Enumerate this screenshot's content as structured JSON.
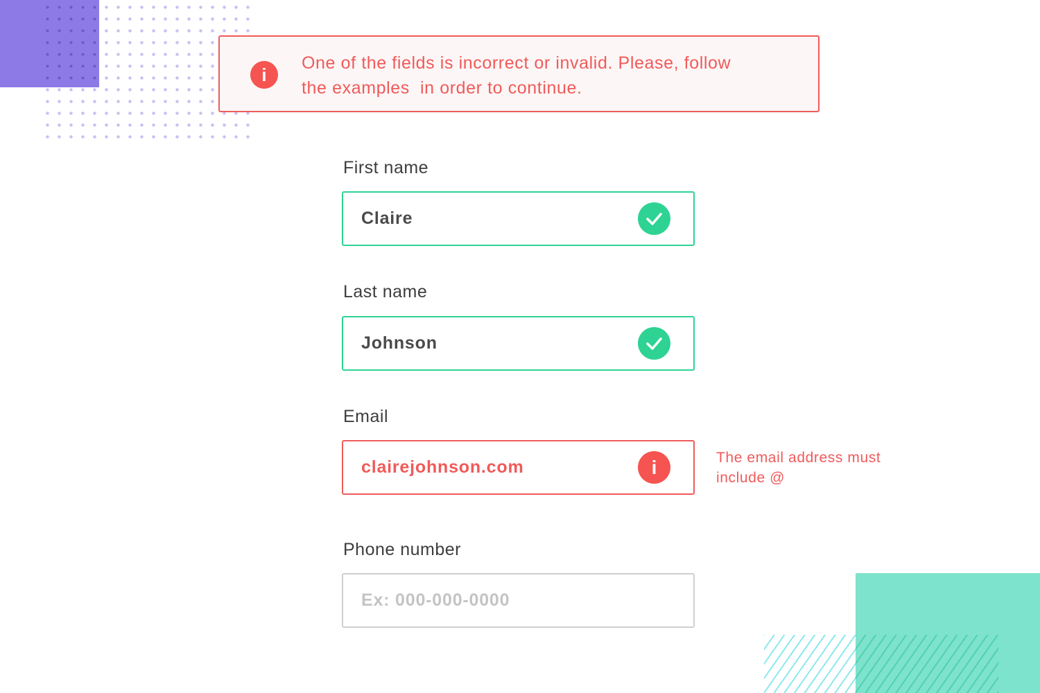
{
  "banner": {
    "icon": "info-icon",
    "icon_glyph": "i",
    "message": "One of the fields is incorrect or invalid. Please, follow\nthe examples  in order to continue."
  },
  "form": {
    "first_name": {
      "label": "First name",
      "value": "Claire",
      "status": "valid",
      "status_icon": "check-icon"
    },
    "last_name": {
      "label": "Last name",
      "value": "Johnson",
      "status": "valid",
      "status_icon": "check-icon"
    },
    "email": {
      "label": "Email",
      "value": "clairejohnson.com",
      "status": "invalid",
      "status_icon": "info-icon",
      "icon_glyph": "i",
      "hint": "The email address must include @"
    },
    "phone": {
      "label": "Phone number",
      "value": "",
      "placeholder": "Ex: 000-000-0000"
    }
  },
  "colors": {
    "error": "#f05a5a",
    "valid": "#2ed394",
    "neutral_border": "#cfcfcf",
    "accent_purple": "#8d7ae6",
    "accent_green": "#7de3cc"
  }
}
